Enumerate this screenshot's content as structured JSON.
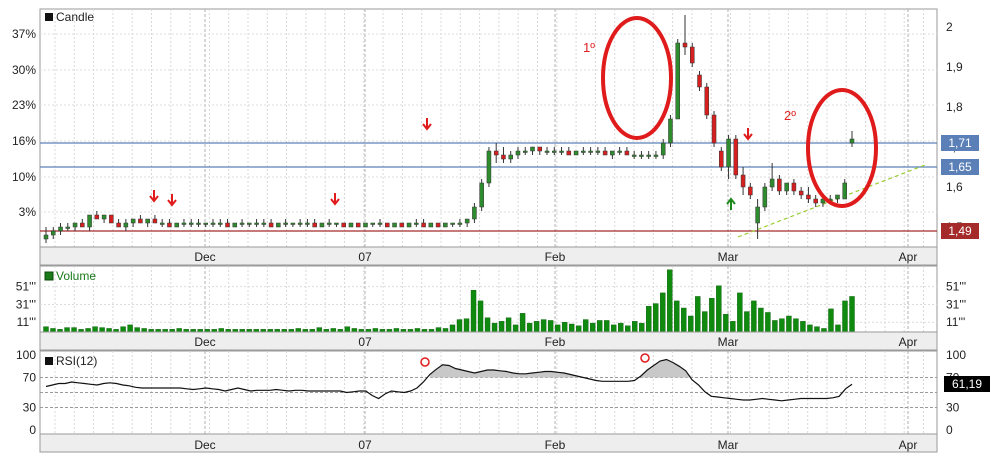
{
  "chart_data": {
    "type": "candlestick",
    "candle_panel": {
      "legend": "Candle",
      "left_ticks": [
        "37%",
        "30%",
        "23%",
        "16%",
        "10%",
        "3%"
      ],
      "right_ticks": [
        "2",
        "1,9",
        "1,8",
        "1,7",
        "1,6",
        "1,5"
      ],
      "y_range": [
        1.47,
        2.03
      ],
      "x_labels": [
        "Dec",
        "07",
        "Feb",
        "Mar",
        "Apr"
      ],
      "reference_lines": [
        {
          "value": 1.71,
          "label": "1,71",
          "color": "#5b80b8"
        },
        {
          "value": 1.65,
          "label": "1,65",
          "color": "#5b80b8"
        },
        {
          "value": 1.49,
          "label": "1,49",
          "color": "#a52a2a"
        }
      ],
      "trend_line": {
        "from": [
          1.48,
          "Mar"
        ],
        "to": [
          1.65,
          "Apr"
        ]
      },
      "annotations": [
        "1º",
        "2º"
      ],
      "candles": [
        {
          "o": 1.47,
          "h": 1.5,
          "l": 1.46,
          "c": 1.48
        },
        {
          "o": 1.48,
          "h": 1.5,
          "l": 1.47,
          "c": 1.49
        },
        {
          "o": 1.49,
          "h": 1.51,
          "l": 1.48,
          "c": 1.5
        },
        {
          "o": 1.5,
          "h": 1.51,
          "l": 1.49,
          "c": 1.5
        },
        {
          "o": 1.5,
          "h": 1.51,
          "l": 1.49,
          "c": 1.51
        },
        {
          "o": 1.51,
          "h": 1.52,
          "l": 1.5,
          "c": 1.5
        },
        {
          "o": 1.5,
          "h": 1.53,
          "l": 1.49,
          "c": 1.53
        },
        {
          "o": 1.53,
          "h": 1.54,
          "l": 1.52,
          "c": 1.52
        },
        {
          "o": 1.52,
          "h": 1.53,
          "l": 1.51,
          "c": 1.53
        },
        {
          "o": 1.53,
          "h": 1.53,
          "l": 1.51,
          "c": 1.51
        },
        {
          "o": 1.51,
          "h": 1.52,
          "l": 1.5,
          "c": 1.5
        },
        {
          "o": 1.5,
          "h": 1.52,
          "l": 1.49,
          "c": 1.51
        },
        {
          "o": 1.51,
          "h": 1.52,
          "l": 1.5,
          "c": 1.52
        },
        {
          "o": 1.52,
          "h": 1.53,
          "l": 1.51,
          "c": 1.51
        },
        {
          "o": 1.51,
          "h": 1.52,
          "l": 1.5,
          "c": 1.52
        },
        {
          "o": 1.52,
          "h": 1.53,
          "l": 1.51,
          "c": 1.51
        },
        {
          "o": 1.51,
          "h": 1.52,
          "l": 1.5,
          "c": 1.51
        },
        {
          "o": 1.51,
          "h": 1.52,
          "l": 1.5,
          "c": 1.5
        },
        {
          "o": 1.5,
          "h": 1.51,
          "l": 1.5,
          "c": 1.51
        },
        {
          "o": 1.51,
          "h": 1.52,
          "l": 1.5,
          "c": 1.51
        },
        {
          "o": 1.51,
          "h": 1.52,
          "l": 1.5,
          "c": 1.51
        },
        {
          "o": 1.51,
          "h": 1.52,
          "l": 1.5,
          "c": 1.51
        },
        {
          "o": 1.51,
          "h": 1.51,
          "l": 1.5,
          "c": 1.51
        },
        {
          "o": 1.51,
          "h": 1.52,
          "l": 1.5,
          "c": 1.51
        },
        {
          "o": 1.51,
          "h": 1.52,
          "l": 1.5,
          "c": 1.51
        },
        {
          "o": 1.51,
          "h": 1.52,
          "l": 1.5,
          "c": 1.5
        },
        {
          "o": 1.5,
          "h": 1.51,
          "l": 1.5,
          "c": 1.51
        },
        {
          "o": 1.51,
          "h": 1.52,
          "l": 1.5,
          "c": 1.51
        },
        {
          "o": 1.51,
          "h": 1.51,
          "l": 1.5,
          "c": 1.51
        },
        {
          "o": 1.51,
          "h": 1.52,
          "l": 1.5,
          "c": 1.51
        },
        {
          "o": 1.51,
          "h": 1.52,
          "l": 1.5,
          "c": 1.51
        },
        {
          "o": 1.51,
          "h": 1.52,
          "l": 1.5,
          "c": 1.5
        },
        {
          "o": 1.5,
          "h": 1.51,
          "l": 1.5,
          "c": 1.51
        },
        {
          "o": 1.51,
          "h": 1.52,
          "l": 1.5,
          "c": 1.51
        },
        {
          "o": 1.51,
          "h": 1.51,
          "l": 1.5,
          "c": 1.51
        },
        {
          "o": 1.51,
          "h": 1.52,
          "l": 1.5,
          "c": 1.51
        },
        {
          "o": 1.51,
          "h": 1.52,
          "l": 1.5,
          "c": 1.51
        },
        {
          "o": 1.51,
          "h": 1.52,
          "l": 1.5,
          "c": 1.5
        },
        {
          "o": 1.5,
          "h": 1.51,
          "l": 1.5,
          "c": 1.51
        },
        {
          "o": 1.51,
          "h": 1.52,
          "l": 1.5,
          "c": 1.51
        },
        {
          "o": 1.51,
          "h": 1.51,
          "l": 1.5,
          "c": 1.51
        },
        {
          "o": 1.51,
          "h": 1.51,
          "l": 1.5,
          "c": 1.5
        },
        {
          "o": 1.5,
          "h": 1.51,
          "l": 1.5,
          "c": 1.51
        },
        {
          "o": 1.51,
          "h": 1.51,
          "l": 1.5,
          "c": 1.5
        },
        {
          "o": 1.5,
          "h": 1.51,
          "l": 1.5,
          "c": 1.51
        },
        {
          "o": 1.51,
          "h": 1.51,
          "l": 1.5,
          "c": 1.51
        },
        {
          "o": 1.51,
          "h": 1.52,
          "l": 1.5,
          "c": 1.51
        },
        {
          "o": 1.51,
          "h": 1.51,
          "l": 1.5,
          "c": 1.5
        },
        {
          "o": 1.5,
          "h": 1.51,
          "l": 1.5,
          "c": 1.51
        },
        {
          "o": 1.51,
          "h": 1.51,
          "l": 1.5,
          "c": 1.5
        },
        {
          "o": 1.5,
          "h": 1.51,
          "l": 1.5,
          "c": 1.51
        },
        {
          "o": 1.51,
          "h": 1.52,
          "l": 1.5,
          "c": 1.51
        },
        {
          "o": 1.51,
          "h": 1.52,
          "l": 1.5,
          "c": 1.5
        },
        {
          "o": 1.5,
          "h": 1.51,
          "l": 1.5,
          "c": 1.51
        },
        {
          "o": 1.51,
          "h": 1.51,
          "l": 1.5,
          "c": 1.5
        },
        {
          "o": 1.5,
          "h": 1.51,
          "l": 1.5,
          "c": 1.51
        },
        {
          "o": 1.51,
          "h": 1.51,
          "l": 1.5,
          "c": 1.51
        },
        {
          "o": 1.51,
          "h": 1.52,
          "l": 1.5,
          "c": 1.51
        },
        {
          "o": 1.51,
          "h": 1.52,
          "l": 1.5,
          "c": 1.52
        },
        {
          "o": 1.52,
          "h": 1.56,
          "l": 1.51,
          "c": 1.55
        },
        {
          "o": 1.55,
          "h": 1.62,
          "l": 1.54,
          "c": 1.61
        },
        {
          "o": 1.61,
          "h": 1.7,
          "l": 1.6,
          "c": 1.69
        },
        {
          "o": 1.69,
          "h": 1.71,
          "l": 1.66,
          "c": 1.68
        },
        {
          "o": 1.68,
          "h": 1.7,
          "l": 1.66,
          "c": 1.67
        },
        {
          "o": 1.67,
          "h": 1.69,
          "l": 1.66,
          "c": 1.68
        },
        {
          "o": 1.68,
          "h": 1.7,
          "l": 1.67,
          "c": 1.69
        },
        {
          "o": 1.69,
          "h": 1.7,
          "l": 1.68,
          "c": 1.69
        },
        {
          "o": 1.69,
          "h": 1.7,
          "l": 1.68,
          "c": 1.7
        },
        {
          "o": 1.7,
          "h": 1.7,
          "l": 1.68,
          "c": 1.69
        },
        {
          "o": 1.69,
          "h": 1.7,
          "l": 1.68,
          "c": 1.69
        },
        {
          "o": 1.69,
          "h": 1.7,
          "l": 1.68,
          "c": 1.69
        },
        {
          "o": 1.69,
          "h": 1.7,
          "l": 1.68,
          "c": 1.69
        },
        {
          "o": 1.69,
          "h": 1.7,
          "l": 1.68,
          "c": 1.68
        },
        {
          "o": 1.68,
          "h": 1.69,
          "l": 1.68,
          "c": 1.69
        },
        {
          "o": 1.69,
          "h": 1.7,
          "l": 1.68,
          "c": 1.69
        },
        {
          "o": 1.69,
          "h": 1.7,
          "l": 1.68,
          "c": 1.69
        },
        {
          "o": 1.69,
          "h": 1.7,
          "l": 1.68,
          "c": 1.69
        },
        {
          "o": 1.69,
          "h": 1.7,
          "l": 1.68,
          "c": 1.68
        },
        {
          "o": 1.68,
          "h": 1.69,
          "l": 1.67,
          "c": 1.69
        },
        {
          "o": 1.69,
          "h": 1.7,
          "l": 1.68,
          "c": 1.69
        },
        {
          "o": 1.69,
          "h": 1.7,
          "l": 1.68,
          "c": 1.68
        },
        {
          "o": 1.68,
          "h": 1.69,
          "l": 1.67,
          "c": 1.68
        },
        {
          "o": 1.68,
          "h": 1.69,
          "l": 1.67,
          "c": 1.68
        },
        {
          "o": 1.68,
          "h": 1.69,
          "l": 1.67,
          "c": 1.68
        },
        {
          "o": 1.68,
          "h": 1.69,
          "l": 1.67,
          "c": 1.68
        },
        {
          "o": 1.68,
          "h": 1.72,
          "l": 1.67,
          "c": 1.71
        },
        {
          "o": 1.71,
          "h": 1.78,
          "l": 1.7,
          "c": 1.77
        },
        {
          "o": 1.77,
          "h": 1.97,
          "l": 1.87,
          "c": 1.96
        },
        {
          "o": 1.96,
          "h": 2.03,
          "l": 1.93,
          "c": 1.95
        },
        {
          "o": 1.95,
          "h": 1.96,
          "l": 1.9,
          "c": 1.91
        },
        {
          "o": 1.88,
          "h": 1.89,
          "l": 1.84,
          "c": 1.85
        },
        {
          "o": 1.85,
          "h": 1.86,
          "l": 1.77,
          "c": 1.78
        },
        {
          "o": 1.78,
          "h": 1.79,
          "l": 1.7,
          "c": 1.71
        },
        {
          "o": 1.69,
          "h": 1.7,
          "l": 1.64,
          "c": 1.65
        },
        {
          "o": 1.65,
          "h": 1.73,
          "l": 1.62,
          "c": 1.72
        },
        {
          "o": 1.72,
          "h": 1.73,
          "l": 1.62,
          "c": 1.63
        },
        {
          "o": 1.63,
          "h": 1.65,
          "l": 1.58,
          "c": 1.6
        },
        {
          "o": 1.6,
          "h": 1.61,
          "l": 1.57,
          "c": 1.58
        },
        {
          "o": 1.51,
          "h": 1.57,
          "l": 1.47,
          "c": 1.55
        },
        {
          "o": 1.55,
          "h": 1.61,
          "l": 1.54,
          "c": 1.6
        },
        {
          "o": 1.6,
          "h": 1.66,
          "l": 1.59,
          "c": 1.62
        },
        {
          "o": 1.62,
          "h": 1.63,
          "l": 1.58,
          "c": 1.59
        },
        {
          "o": 1.59,
          "h": 1.61,
          "l": 1.58,
          "c": 1.61
        },
        {
          "o": 1.61,
          "h": 1.62,
          "l": 1.58,
          "c": 1.59
        },
        {
          "o": 1.59,
          "h": 1.6,
          "l": 1.57,
          "c": 1.58
        },
        {
          "o": 1.58,
          "h": 1.6,
          "l": 1.56,
          "c": 1.57
        },
        {
          "o": 1.57,
          "h": 1.58,
          "l": 1.55,
          "c": 1.56
        },
        {
          "o": 1.56,
          "h": 1.58,
          "l": 1.55,
          "c": 1.57
        },
        {
          "o": 1.57,
          "h": 1.58,
          "l": 1.56,
          "c": 1.57
        },
        {
          "o": 1.57,
          "h": 1.58,
          "l": 1.56,
          "c": 1.58
        },
        {
          "o": 1.57,
          "h": 1.62,
          "l": 1.57,
          "c": 1.61
        },
        {
          "o": 1.71,
          "h": 1.74,
          "l": 1.7,
          "c": 1.72
        }
      ]
    },
    "volume_panel": {
      "legend": "Volume",
      "right_ticks": [
        "51'''",
        "31'''",
        "11'''"
      ],
      "left_ticks": [
        "51'''",
        "31'''",
        "11'''"
      ],
      "y_range": [
        0,
        72
      ],
      "values": [
        6,
        4,
        3,
        5,
        5,
        3,
        4,
        6,
        5,
        4,
        3,
        6,
        8,
        5,
        4,
        3,
        3,
        3,
        3,
        4,
        3,
        3,
        3,
        3,
        3,
        4,
        3,
        3,
        3,
        3,
        3,
        3,
        3,
        3,
        3,
        3,
        4,
        3,
        3,
        5,
        3,
        4,
        3,
        6,
        4,
        3,
        3,
        4,
        3,
        3,
        4,
        3,
        3,
        4,
        3,
        3,
        5,
        4,
        8,
        14,
        15,
        47,
        35,
        16,
        10,
        12,
        16,
        8,
        21,
        10,
        12,
        14,
        13,
        8,
        11,
        9,
        7,
        14,
        10,
        13,
        13,
        8,
        10,
        7,
        12,
        10,
        29,
        32,
        44,
        70,
        35,
        27,
        18,
        40,
        23,
        38,
        52,
        20,
        12,
        44,
        23,
        35,
        27,
        22,
        13,
        15,
        18,
        15,
        12,
        8,
        6,
        4,
        26,
        8,
        35,
        40
      ]
    },
    "rsi_panel": {
      "legend": "RSI(12)",
      "left_ticks": [
        "100",
        "70",
        "30",
        "0"
      ],
      "right_ticks": [
        "100",
        "70",
        "30",
        "0"
      ],
      "reference_lines": [
        70,
        50,
        30
      ],
      "y_range": [
        0,
        100
      ],
      "current_value": "61,19",
      "values": [
        58,
        60,
        62,
        62,
        64,
        63,
        62,
        61,
        60,
        62,
        63,
        62,
        60,
        59,
        57,
        56,
        56,
        56,
        56,
        56,
        56,
        56,
        55,
        54,
        55,
        56,
        55,
        54,
        52,
        54,
        56,
        54,
        52,
        53,
        53,
        53,
        54,
        53,
        52,
        53,
        53,
        52,
        52,
        52,
        52,
        52,
        52,
        50,
        51,
        52,
        52,
        46,
        42,
        48,
        52,
        51,
        50,
        52,
        56,
        64,
        74,
        81,
        87,
        86,
        82,
        80,
        78,
        76,
        78,
        80,
        80,
        79,
        78,
        76,
        75,
        75,
        76,
        77,
        78,
        78,
        77,
        76,
        74,
        72,
        70,
        68,
        66,
        65,
        65,
        65,
        65,
        65,
        66,
        72,
        80,
        86,
        92,
        94,
        90,
        85,
        79,
        67,
        60,
        51,
        45,
        44,
        43,
        42,
        41,
        40,
        40,
        41,
        42,
        41,
        40,
        39,
        40,
        41,
        42,
        42,
        42,
        42,
        42,
        43,
        45,
        55,
        61
      ]
    }
  }
}
